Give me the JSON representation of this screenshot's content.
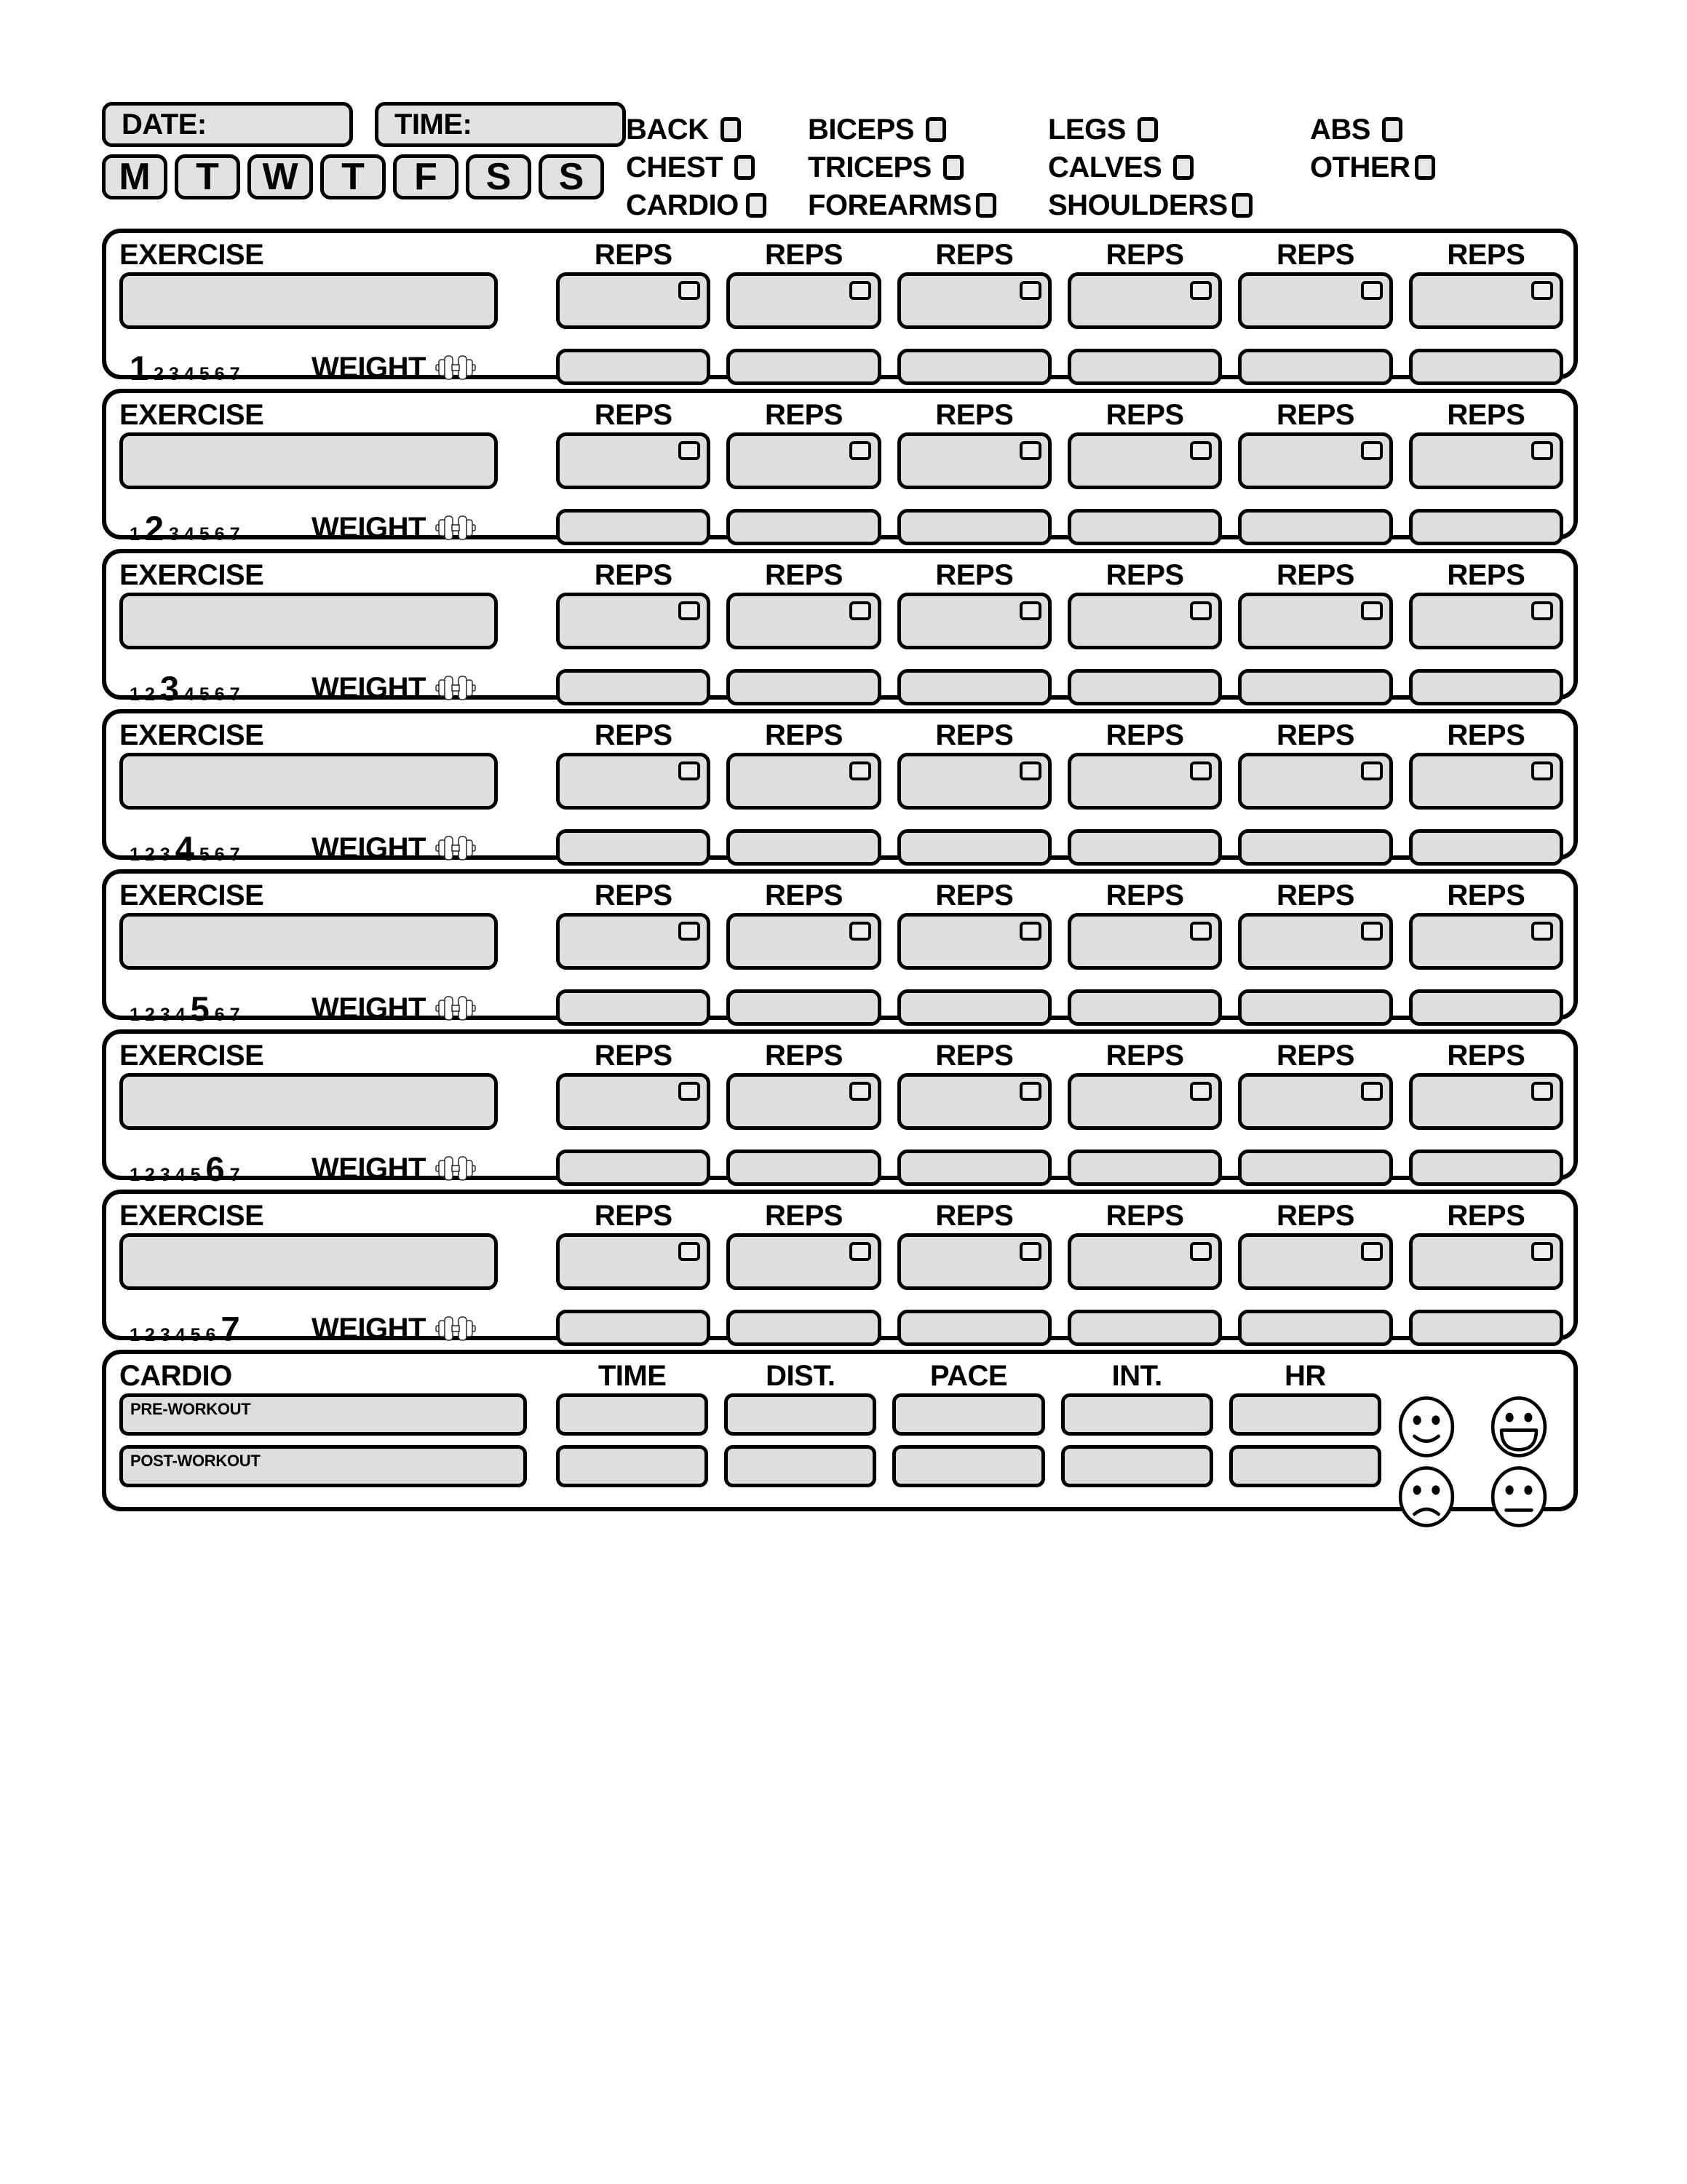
{
  "header": {
    "date_label": "DATE:",
    "time_label": "TIME:",
    "days": [
      "M",
      "T",
      "W",
      "T",
      "F",
      "S",
      "S"
    ],
    "muscle_rows": [
      [
        {
          "label": "BACK"
        },
        {
          "label": "BICEPS"
        },
        {
          "label": "LEGS"
        },
        {
          "label": "ABS"
        }
      ],
      [
        {
          "label": "CHEST"
        },
        {
          "label": "TRICEPS"
        },
        {
          "label": "CALVES"
        },
        {
          "label": "OTHER"
        }
      ],
      [
        {
          "label": "CARDIO"
        },
        {
          "label": "FOREARMS"
        },
        {
          "label": "SHOULDERS"
        }
      ]
    ]
  },
  "exercise": {
    "title_label": "EXERCISE",
    "reps_label": "REPS",
    "weight_label": "WEIGHT",
    "set_count": 6,
    "numbers": [
      "1",
      "2",
      "3",
      "4",
      "5",
      "6",
      "7"
    ],
    "blocks": [
      {
        "active": 1
      },
      {
        "active": 2
      },
      {
        "active": 3
      },
      {
        "active": 4
      },
      {
        "active": 5
      },
      {
        "active": 6
      },
      {
        "active": 7
      }
    ]
  },
  "cardio": {
    "title_label": "CARDIO",
    "columns": [
      "TIME",
      "DIST.",
      "PACE",
      "INT.",
      "HR"
    ],
    "rows": [
      {
        "label": "PRE-WORKOUT"
      },
      {
        "label": "POST-WORKOUT"
      }
    ],
    "faces": [
      "smile-face",
      "grin-face",
      "sad-face",
      "neutral-face"
    ]
  },
  "colors": {
    "ink": "#000000",
    "field_fill": "#dedede",
    "checkbox_fill": "#ededed",
    "paper": "#ffffff"
  }
}
